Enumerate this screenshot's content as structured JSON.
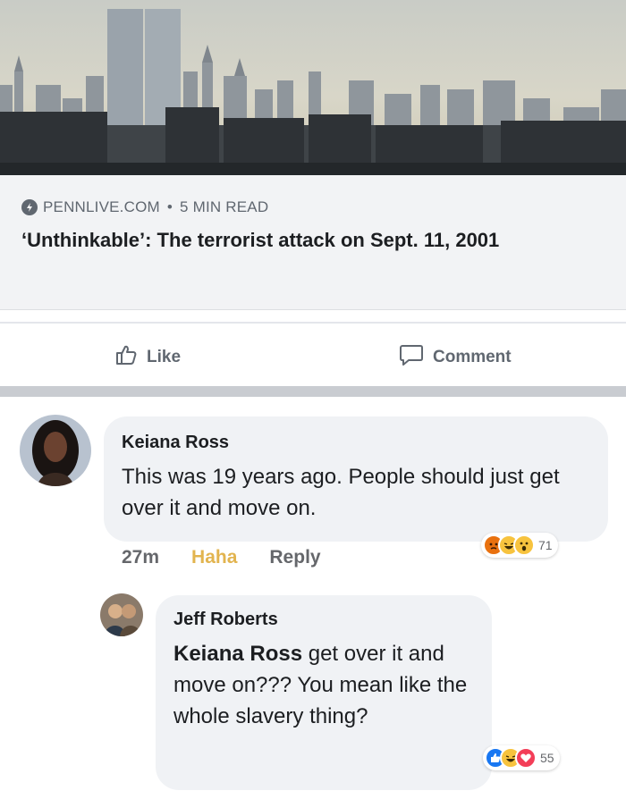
{
  "post": {
    "source": "PENNLIVE.COM",
    "separator": "•",
    "read_time": "5 MIN READ",
    "headline": "‘Unthinkable’: The terrorist attack on Sept. 11, 2001"
  },
  "actions": {
    "like_label": "Like",
    "comment_label": "Comment"
  },
  "comments": [
    {
      "author": "Keiana Ross",
      "text": "This was 19 years ago. People should just get over it and move on.",
      "time": "27m",
      "reaction_label": "Haha",
      "reply_label": "Reply",
      "reactions": [
        "angry",
        "haha",
        "wow"
      ],
      "reaction_count": "71"
    },
    {
      "author": "Jeff Roberts",
      "mention": "Keiana Ross",
      "text": "get over it and move on??? You mean like the whole slavery thing?",
      "reactions": [
        "like",
        "haha",
        "love"
      ],
      "reaction_count": "55"
    }
  ],
  "colors": {
    "link_box_bg": "#f2f3f5",
    "haha": "#e2b44f",
    "like_blue": "#1877f2",
    "love_red": "#f33e58",
    "angry_orange": "#e9710f"
  }
}
